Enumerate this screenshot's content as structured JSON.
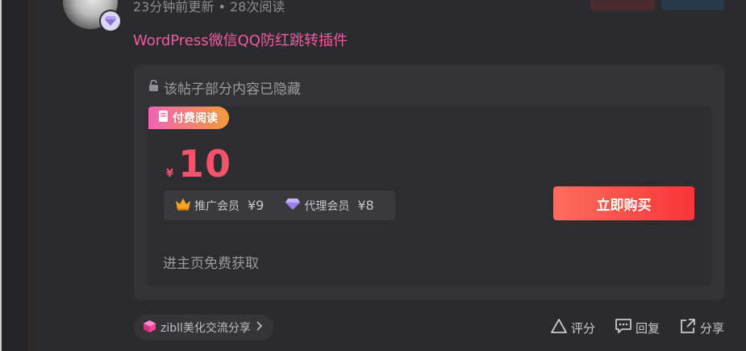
{
  "post": {
    "meta": "23分钟前更新 • 28次阅读",
    "title": "WordPress微信QQ防红跳转插件",
    "hidden_tip": "该帖子部分内容已隐藏"
  },
  "paywall": {
    "badge_label": "付费阅读",
    "currency": "¥",
    "price": "10",
    "members": [
      {
        "label": "推广会员",
        "price": "¥9",
        "icon": "crown-icon"
      },
      {
        "label": "代理会员",
        "price": "¥8",
        "icon": "diamond-icon"
      }
    ],
    "buy_label": "立即购买",
    "free_tip": "进主页免费获取"
  },
  "footer": {
    "tag_label": "zibll美化交流分享",
    "actions": [
      {
        "label": "评分",
        "icon": "triangle-rate-icon"
      },
      {
        "label": "回复",
        "icon": "comment-icon"
      },
      {
        "label": "分享",
        "icon": "share-icon"
      }
    ]
  },
  "colors": {
    "title": "#f05aa0",
    "price": "#f6526c",
    "buy_gradient_start": "#fb6e5c",
    "buy_gradient_end": "#f83535",
    "badge_gradient_start": "#f064b4",
    "badge_gradient_end": "#f29a3a"
  }
}
